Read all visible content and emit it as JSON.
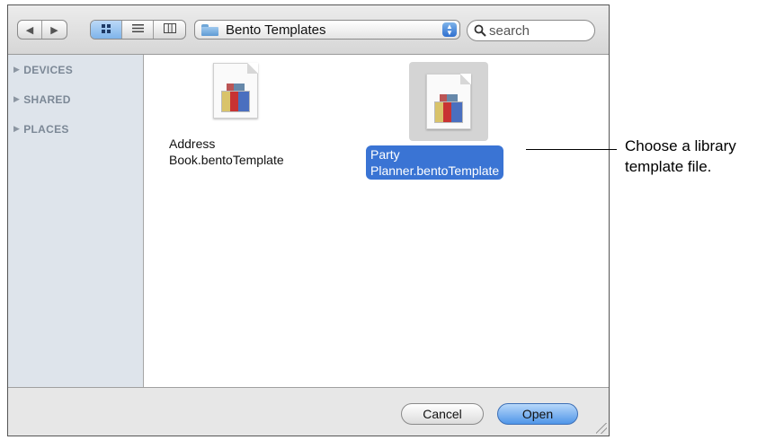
{
  "toolbar": {
    "back_icon": "back-arrow-icon",
    "forward_icon": "forward-arrow-icon",
    "view_modes": [
      "icon-view",
      "list-view",
      "column-view"
    ],
    "location": "Bento Templates",
    "search_placeholder": "search"
  },
  "sidebar": {
    "items": [
      {
        "label": "DEVICES"
      },
      {
        "label": "SHARED"
      },
      {
        "label": "PLACES"
      }
    ]
  },
  "files": [
    {
      "line1": "Address",
      "line2": "Book.bentoTemplate",
      "selected": false
    },
    {
      "line1": "Party",
      "line2": "Planner.bentoTemplate",
      "selected": true
    }
  ],
  "buttons": {
    "cancel": "Cancel",
    "open": "Open"
  },
  "callout": {
    "line1": "Choose a library",
    "line2": "template file."
  },
  "colors": {
    "selection": "#3a74d4",
    "sidebar": "#dee4eb",
    "default_button": "#4f95e8"
  }
}
